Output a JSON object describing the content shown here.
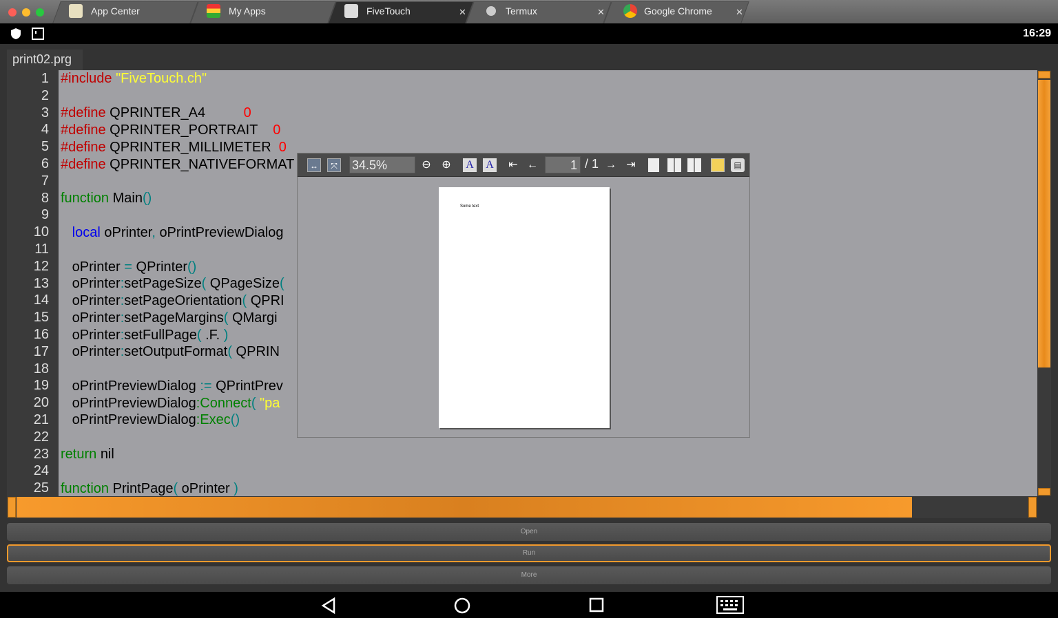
{
  "tabs": [
    {
      "label": "App Center"
    },
    {
      "label": "My Apps"
    },
    {
      "label": "FiveTouch"
    },
    {
      "label": "Termux"
    },
    {
      "label": "Google Chrome"
    }
  ],
  "status": {
    "time": "16:29"
  },
  "editor": {
    "filename": "print02.prg",
    "line_numbers": [
      "1",
      "2",
      "3",
      "4",
      "5",
      "6",
      "7",
      "8",
      "9",
      "10",
      "11",
      "12",
      "13",
      "14",
      "15",
      "16",
      "17",
      "18",
      "19",
      "20",
      "21",
      "22",
      "23",
      "24",
      "25"
    ]
  },
  "preview": {
    "zoom": "34.5%",
    "page": "1",
    "page_total": "/ 1",
    "page_text": "Some text"
  },
  "actions": {
    "open": "Open",
    "run": "Run",
    "more": "More"
  },
  "colors": {
    "accent": "#f29a2c",
    "window_bg": "#333333"
  }
}
